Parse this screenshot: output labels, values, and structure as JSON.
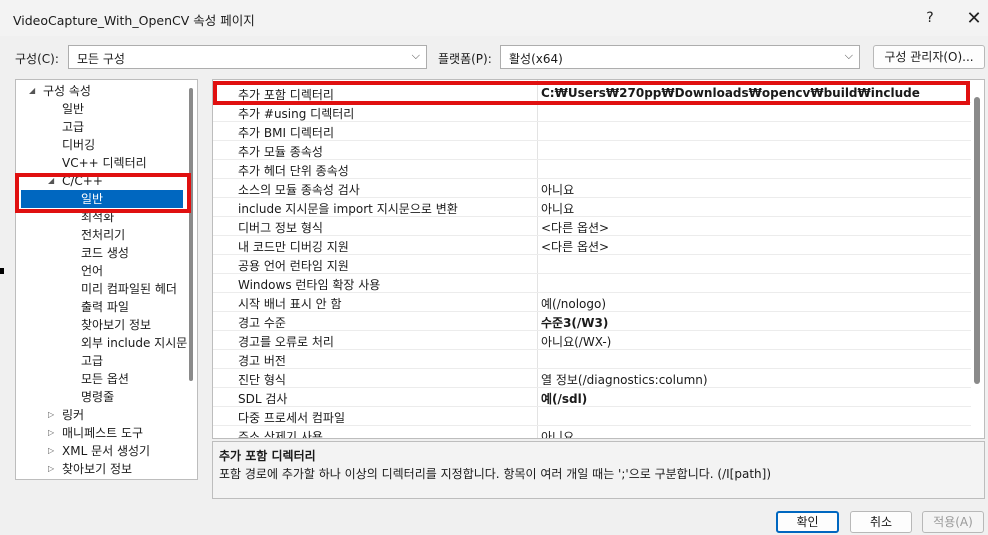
{
  "window": {
    "title": "VideoCapture_With_OpenCV 속성 페이지",
    "help_glyph": "?",
    "close_glyph": "✕"
  },
  "toolbar": {
    "config_label": "구성(C):",
    "config_value": "모든 구성",
    "platform_label": "플랫폼(P):",
    "platform_value": "활성(x64)",
    "config_manager_label": "구성 관리자(O)..."
  },
  "tree": {
    "items": [
      {
        "label": "구성 속성",
        "expander": "◢"
      },
      {
        "label": "일반"
      },
      {
        "label": "고급"
      },
      {
        "label": "디버깅"
      },
      {
        "label": "VC++ 디렉터리"
      },
      {
        "label": "C/C++",
        "expander": "◢"
      },
      {
        "label": "일반",
        "selected": true
      },
      {
        "label": "최적화"
      },
      {
        "label": "전처리기"
      },
      {
        "label": "코드 생성"
      },
      {
        "label": "언어"
      },
      {
        "label": "미리 컴파일된 헤더"
      },
      {
        "label": "출력 파일"
      },
      {
        "label": "찾아보기 정보"
      },
      {
        "label": "외부 include 지시문"
      },
      {
        "label": "고급"
      },
      {
        "label": "모든 옵션"
      },
      {
        "label": "명령줄"
      },
      {
        "label": "링커",
        "expander": "▷"
      },
      {
        "label": "매니페스트 도구",
        "expander": "▷"
      },
      {
        "label": "XML 문서 생성기",
        "expander": "▷"
      },
      {
        "label": "찾아보기 정보",
        "expander": "▷"
      }
    ]
  },
  "properties": {
    "rows": [
      {
        "name": "추가 포함 디렉터리",
        "value": "C:₩Users₩270pp₩Downloads₩opencv₩build₩include",
        "bold": true
      },
      {
        "name": "추가 #using 디렉터리",
        "value": ""
      },
      {
        "name": "추가 BMI 디렉터리",
        "value": ""
      },
      {
        "name": "추가 모듈 종속성",
        "value": ""
      },
      {
        "name": "추가 헤더 단위 종속성",
        "value": ""
      },
      {
        "name": "소스의 모듈 종속성 검사",
        "value": "아니요"
      },
      {
        "name": "include 지시문을 import 지시문으로 변환",
        "value": "아니요"
      },
      {
        "name": "디버그 정보 형식",
        "value": "<다른 옵션>"
      },
      {
        "name": "내 코드만 디버깅 지원",
        "value": "<다른 옵션>"
      },
      {
        "name": "공용 언어 런타임 지원",
        "value": ""
      },
      {
        "name": "Windows 런타임 확장 사용",
        "value": ""
      },
      {
        "name": "시작 배너 표시 안 함",
        "value": "예(/nologo)"
      },
      {
        "name": "경고 수준",
        "value": "수준3(/W3)",
        "bold": true
      },
      {
        "name": "경고를 오류로 처리",
        "value": "아니요(/WX-)"
      },
      {
        "name": "경고 버전",
        "value": ""
      },
      {
        "name": "진단 형식",
        "value": "열 정보(/diagnostics:column)"
      },
      {
        "name": "SDL 검사",
        "value": "예(/sdl)",
        "bold": true
      },
      {
        "name": "다중 프로세서 컴파일",
        "value": ""
      },
      {
        "name": "주소 삭제기 사용",
        "value": "아니요"
      }
    ]
  },
  "description": {
    "title": "추가 포함 디렉터리",
    "text": "포함 경로에 추가할 하나 이상의 디렉터리를 지정합니다. 항목이 여러 개일 때는 ';'으로 구분합니다. (/I[path])"
  },
  "buttons": {
    "ok": "확인",
    "cancel": "취소",
    "apply": "적용(A)"
  },
  "colors": {
    "selection": "#0067c0",
    "highlight_annotation": "#e01010"
  }
}
